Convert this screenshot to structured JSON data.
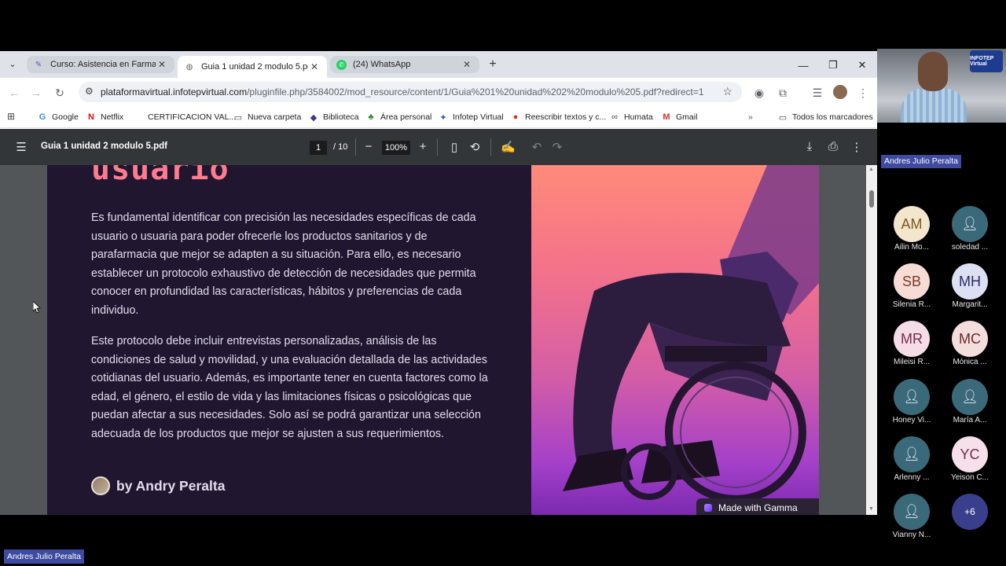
{
  "tabs": [
    {
      "title": "Curso: Asistencia en Farmacia A",
      "icon": "moodle-icon"
    },
    {
      "title": "Guia 1 unidad 2 modulo 5.pdf",
      "icon": "globe-icon"
    },
    {
      "title": "(24) WhatsApp",
      "icon": "whatsapp-icon"
    }
  ],
  "omnibox": {
    "domain": "plataformavirtual.infotepvirtual.com",
    "path": "/pluginfile.php/3584002/mod_resource/content/1/Guia%201%20unidad%202%20modulo%205.pdf?redirect=1"
  },
  "bookmarks": [
    {
      "label": "Google",
      "icon": "G",
      "color": "#4285f4"
    },
    {
      "label": "Netflix",
      "icon": "N",
      "color": "#e50914"
    },
    {
      "label": "CERTIFICACION VAL...",
      "icon": "",
      "color": "#888"
    },
    {
      "label": "Nueva carpeta",
      "icon": "▭",
      "color": "#444"
    },
    {
      "label": "Biblioteca",
      "icon": "◆",
      "color": "#3b3b8f"
    },
    {
      "label": "Área personal",
      "icon": "♣",
      "color": "#2a8a3a"
    },
    {
      "label": "Infotep Virtual",
      "icon": "✦",
      "color": "#2a5aa8"
    },
    {
      "label": "Reescribir textos y c...",
      "icon": "●",
      "color": "#e03030"
    },
    {
      "label": "Humata",
      "icon": "∞",
      "color": "#444"
    },
    {
      "label": "Gmail",
      "icon": "M",
      "color": "#d93025"
    }
  ],
  "all_bookmarks": "Todos los marcadores",
  "pdf": {
    "title": "Guia 1 unidad 2 modulo 5.pdf",
    "page": "1",
    "total": "/ 10",
    "zoom": "100%"
  },
  "document": {
    "heading": "usuario",
    "paragraph1": "Es fundamental identificar con precisión las necesidades específicas de cada usuario o usuaria para poder ofrecerle los productos sanitarios y de parafarmacia que mejor se adapten a su situación. Para ello, es necesario establecer un protocolo exhaustivo de detección de necesidades que permita conocer en profundidad las características, hábitos y preferencias de cada individuo.",
    "paragraph2": "Este protocolo debe incluir entrevistas personalizadas, análisis de las condiciones de salud y movilidad, y una evaluación detallada de las actividades cotidianas del usuario. Además, es importante tener en cuenta factores como la edad, el género, el estilo de vida y las limitaciones físicas o psicológicas que puedan afectar a sus necesidades. Solo así se podrá garantizar una selección adecuada de los productos que mejor se ajusten a sus requerimientos.",
    "byline": "by Andry Peralta",
    "badge": "Made with Gamma"
  },
  "meeting": {
    "presenter": "Andres Julio Peralta",
    "logo_text": "INFOTEP Virtual",
    "participants": [
      {
        "initials": "AM",
        "name": "Ailin Mo...",
        "bg": "#f3e6cc",
        "fg": "#7a5a20"
      },
      {
        "initials": "",
        "name": "soledad ...",
        "bg": "teal",
        "fg": "#fff"
      },
      {
        "initials": "SB",
        "name": "Silenia  R...",
        "bg": "#f6dcd4",
        "fg": "#7a3a2a"
      },
      {
        "initials": "MH",
        "name": "Margarit...",
        "bg": "#dde0f2",
        "fg": "#2a2a6a"
      },
      {
        "initials": "MR",
        "name": "Mileisi R...",
        "bg": "#f4dde6",
        "fg": "#7a2a4a"
      },
      {
        "initials": "MC",
        "name": "Mónica ...",
        "bg": "#f4dddd",
        "fg": "#6a2a2a"
      },
      {
        "initials": "",
        "name": "Honey Vi...",
        "bg": "teal",
        "fg": "#fff"
      },
      {
        "initials": "",
        "name": "María A...",
        "bg": "teal",
        "fg": "#fff"
      },
      {
        "initials": "",
        "name": "Arlenny ...",
        "bg": "teal",
        "fg": "#fff"
      },
      {
        "initials": "YC",
        "name": "Yeison C...",
        "bg": "#f6e0ea",
        "fg": "#7a2a50"
      },
      {
        "initials": "",
        "name": "Vianny N...",
        "bg": "teal",
        "fg": "#fff"
      },
      {
        "initials": "+6",
        "name": "",
        "bg": "more",
        "fg": "#fff"
      }
    ],
    "bottom_tag": "Andres Julio Peralta"
  }
}
